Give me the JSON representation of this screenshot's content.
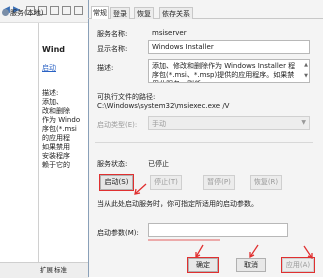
{
  "background_window": {
    "tree_item": "服务(本地)",
    "pane_title": "Wind",
    "pane_link": "启动",
    "pane_desc_header": "描述:",
    "pane_desc_lines": [
      "添加、",
      "改和删除",
      "作为 Windo",
      "序包(*.msi",
      "的应用程",
      "如果禁用",
      "安装程序",
      "赖于它的"
    ],
    "tab_extended": "扩展",
    "tab_standard": "标准"
  },
  "dialog": {
    "tabs": [
      {
        "label": "常规",
        "active": true
      },
      {
        "label": "登录",
        "active": false
      },
      {
        "label": "恢复",
        "active": false
      },
      {
        "label": "依存关系",
        "active": false
      }
    ],
    "service_name_label": "服务名称:",
    "service_name": "msiserver",
    "display_name_label": "显示名称:",
    "display_name": "Windows Installer",
    "description_label": "描述:",
    "description": "添加、修改和删除作为 Windows Installer 程序包(*.msi、*.msp)提供的应用程序。如果禁用此服务，则任",
    "exe_path_label": "可执行文件的路径:",
    "exe_path": "C:\\Windows\\system32\\msiexec.exe /V",
    "startup_type_label": "启动类型(E):",
    "startup_type": "手动",
    "status_label": "服务状态:",
    "status_value": "已停止",
    "buttons": {
      "start": "启动(S)",
      "stop": "停止(T)",
      "pause": "暂停(P)",
      "resume": "恢复(R)"
    },
    "hint": "当从此处启动服务时，你可指定所适用的启动参数。",
    "params_label": "启动参数(M):",
    "params_value": "",
    "footer": {
      "ok": "确定",
      "cancel": "取消",
      "apply": "应用(A)"
    }
  },
  "colors": {
    "accent_red": "#e03030",
    "link_blue": "#2a62c4"
  }
}
